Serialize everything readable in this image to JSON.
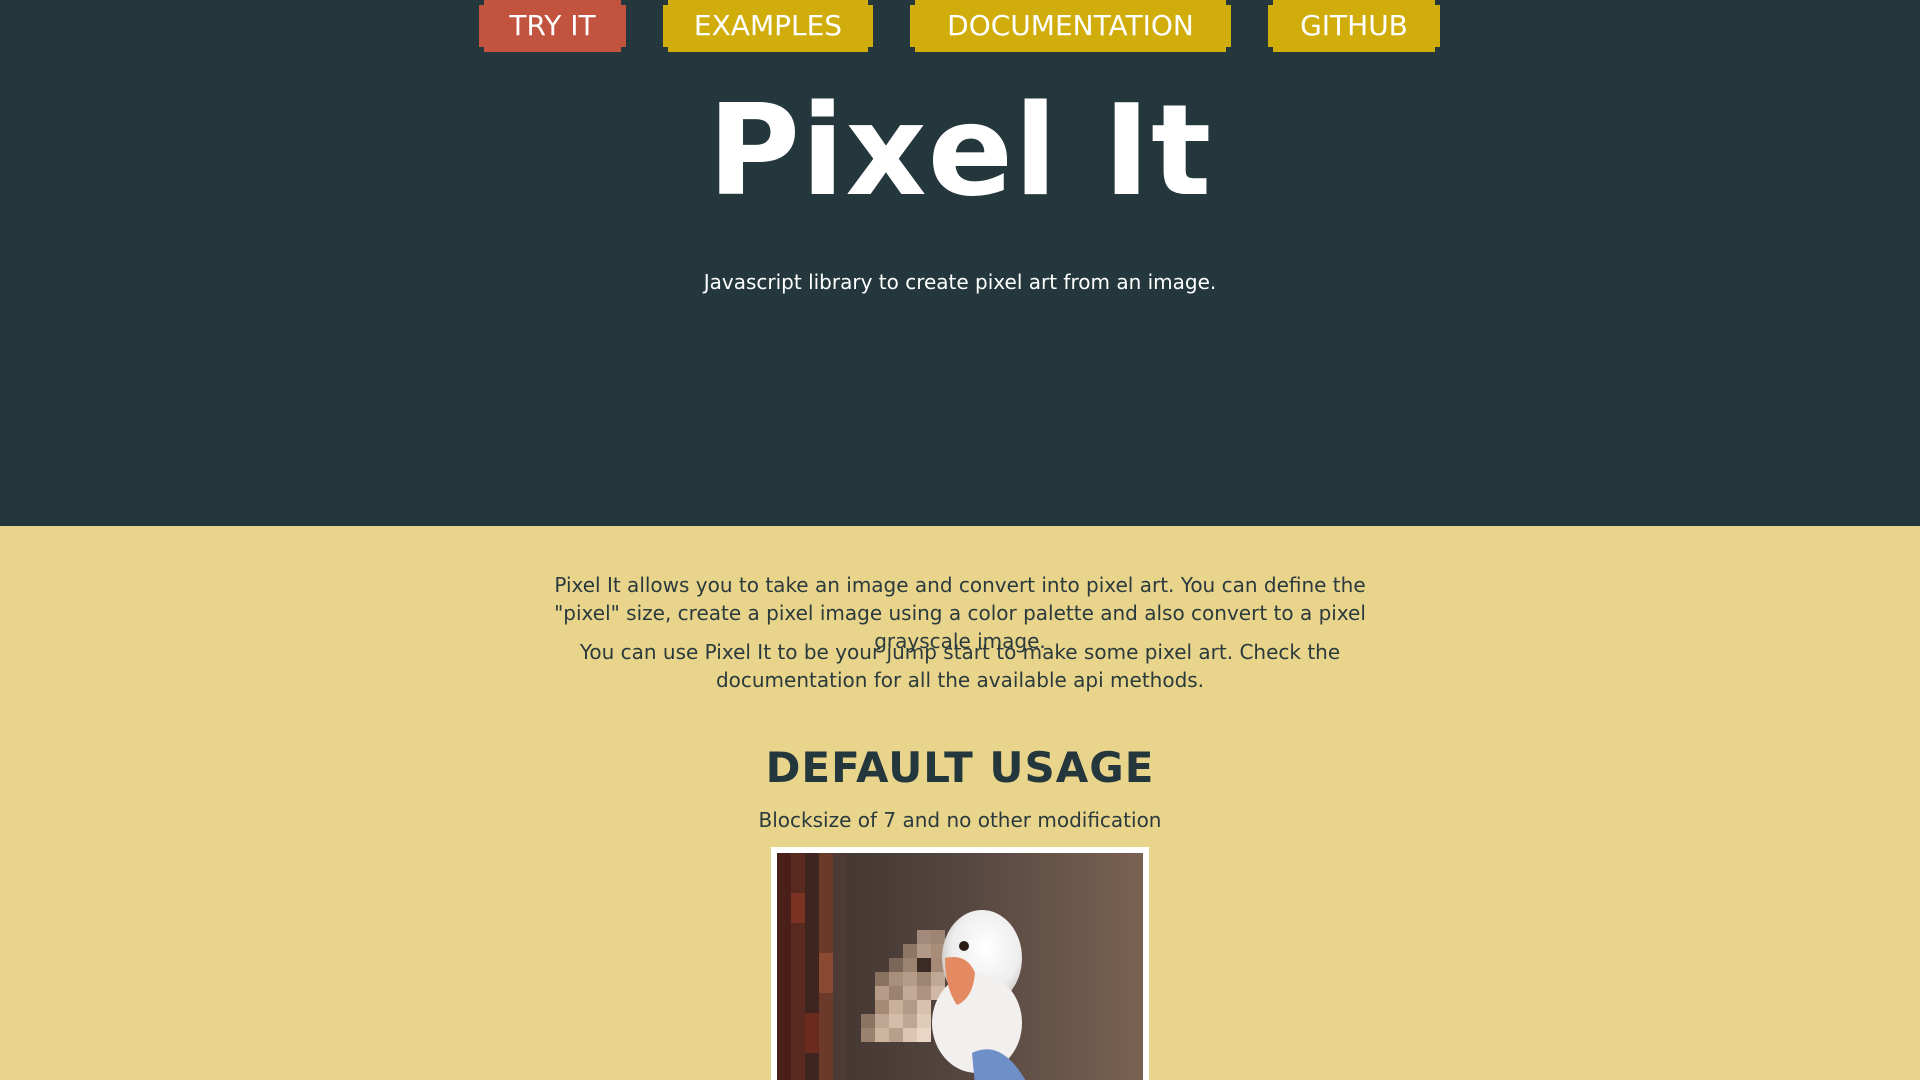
{
  "hero": {
    "title": "Pixel It",
    "subtitle": "Javascript library to create pixel art from an image.",
    "background": "#24373d"
  },
  "nav": {
    "buttons": [
      {
        "label": "TRY IT",
        "color": "#c2533f"
      },
      {
        "label": "EXAMPLES",
        "color": "#d1ad0c"
      },
      {
        "label": "DOCUMENTATION",
        "color": "#d1ad0c"
      },
      {
        "label": "GITHUB",
        "color": "#d1ad0c"
      }
    ]
  },
  "content": {
    "background": "#e8d48b",
    "paragraphs": [
      "Pixel It allows you to take an image and convert into pixel art. You can define the \"pixel\" size, create a pixel image using a color palette and also convert to a pixel grayscale image.",
      "You can use Pixel It to be your jump start to make some pixel art. Check the documentation for all the available api methods."
    ]
  },
  "default_usage": {
    "title": "DEFAULT USAGE",
    "subtitle": "Blocksize of 7 and no other modification",
    "image_icon": "pixelated-bird-photo"
  }
}
